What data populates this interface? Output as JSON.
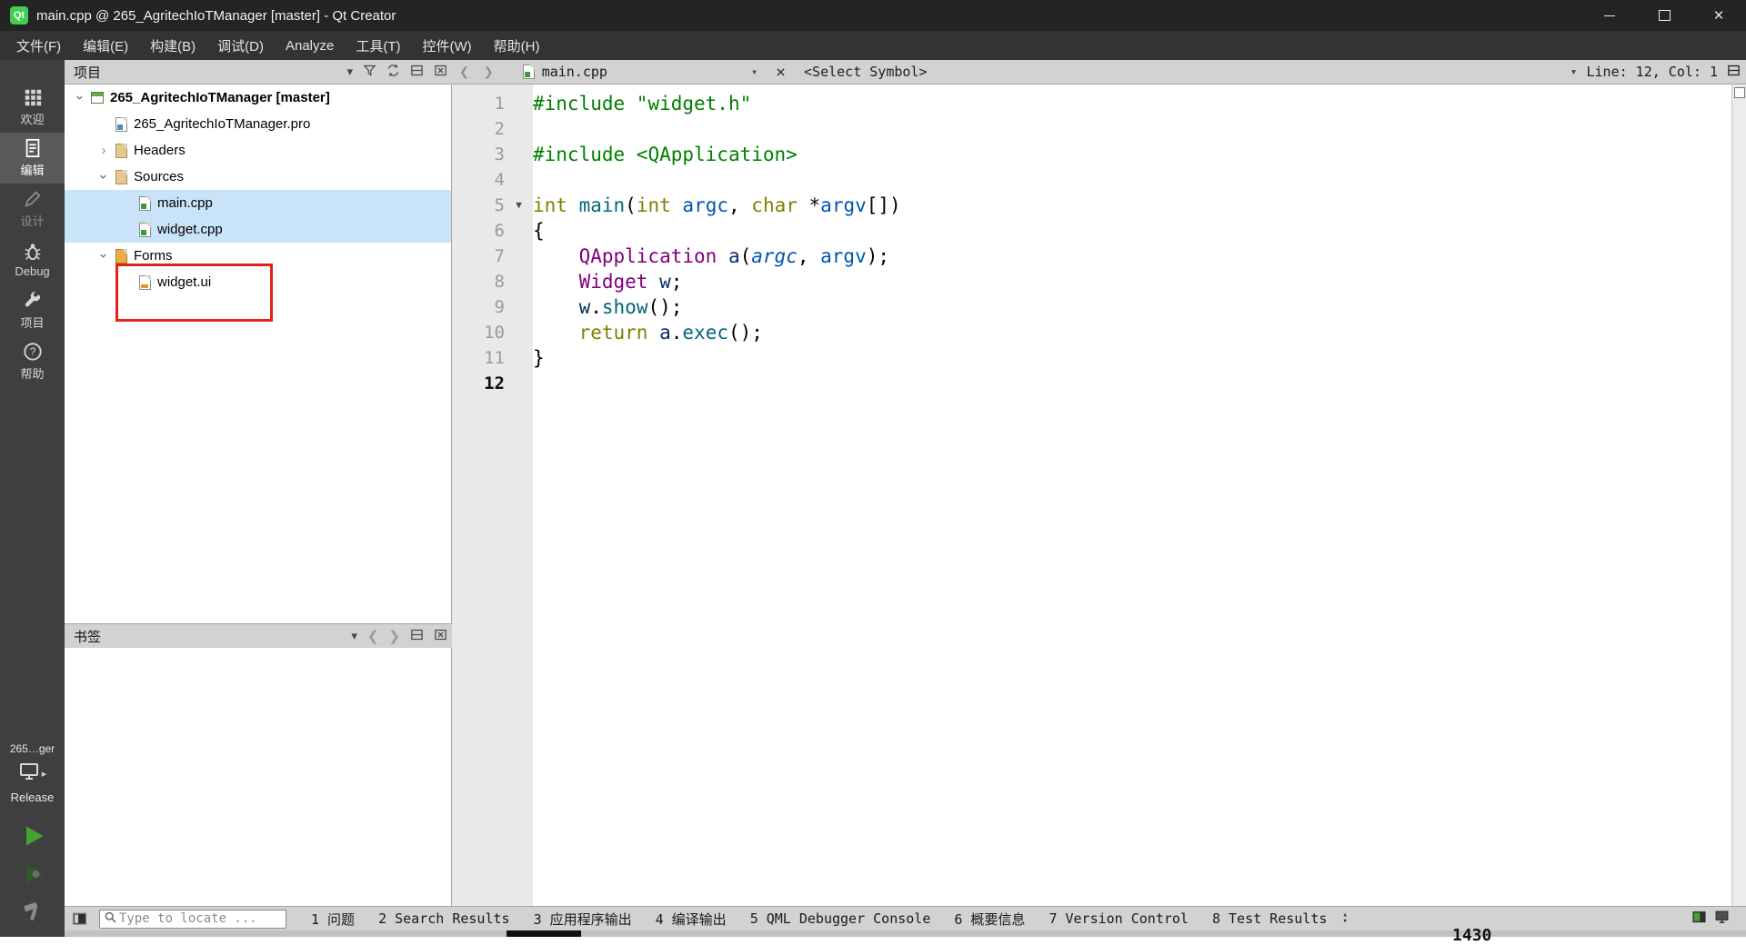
{
  "window": {
    "title": "main.cpp @ 265_AgritechIoTManager [master] - Qt Creator",
    "logo_text": "Qt"
  },
  "menu": {
    "items": [
      "文件(F)",
      "编辑(E)",
      "构建(B)",
      "调试(D)",
      "Analyze",
      "工具(T)",
      "控件(W)",
      "帮助(H)"
    ]
  },
  "modebar": {
    "items": [
      {
        "id": "welcome",
        "label": "欢迎",
        "icon": "grid-icon",
        "state": "normal"
      },
      {
        "id": "edit",
        "label": "编辑",
        "icon": "document-icon",
        "state": "selected"
      },
      {
        "id": "design",
        "label": "设计",
        "icon": "pencil-icon",
        "state": "disabled"
      },
      {
        "id": "debug",
        "label": "Debug",
        "icon": "bug-icon",
        "state": "normal"
      },
      {
        "id": "projects",
        "label": "项目",
        "icon": "wrench-icon",
        "state": "normal"
      },
      {
        "id": "help",
        "label": "帮助",
        "icon": "help-icon",
        "state": "normal"
      }
    ],
    "kit": {
      "project": "265…ger",
      "config": "Release"
    },
    "actions": [
      {
        "id": "run",
        "icon": "run-icon"
      },
      {
        "id": "run-debug",
        "icon": "run-debug-icon"
      },
      {
        "id": "build",
        "icon": "hammer-icon"
      }
    ]
  },
  "project_panel": {
    "title": "项目",
    "tree": [
      {
        "label": "265_AgritechIoTManager [master]",
        "level": 0,
        "icon": "project-icon",
        "chevron": "down",
        "bold": true
      },
      {
        "label": "265_AgritechIoTManager.pro",
        "level": 1,
        "icon": "profile-file-icon",
        "chevron": null
      },
      {
        "label": "Headers",
        "level": 1,
        "icon": "headers-group-icon",
        "chevron": "right"
      },
      {
        "label": "Sources",
        "level": 1,
        "icon": "sources-group-icon",
        "chevron": "down"
      },
      {
        "label": "main.cpp",
        "level": 2,
        "icon": "cpp-file-icon",
        "chevron": null,
        "selected": true
      },
      {
        "label": "widget.cpp",
        "level": 2,
        "icon": "cpp-file-icon",
        "chevron": null,
        "selected": true
      },
      {
        "label": "Forms",
        "level": 1,
        "icon": "forms-group-icon",
        "chevron": "down"
      },
      {
        "label": "widget.ui",
        "level": 2,
        "icon": "ui-file-icon",
        "chevron": null,
        "annotated": true
      }
    ],
    "annotation_color": "#e0241a"
  },
  "bookmarks_panel": {
    "title": "书签"
  },
  "editor": {
    "file_tab": "main.cpp",
    "symbol_selector": "<Select Symbol>",
    "cursor": "Line: 12, Col: 1",
    "code": [
      {
        "n": "1",
        "segs": [
          [
            "pp",
            "#include "
          ],
          [
            "str",
            "\"widget.h\""
          ]
        ]
      },
      {
        "n": "2",
        "segs": []
      },
      {
        "n": "3",
        "segs": [
          [
            "pp",
            "#include "
          ],
          [
            "str",
            "<QApplication>"
          ]
        ]
      },
      {
        "n": "4",
        "segs": []
      },
      {
        "n": "5",
        "fold": true,
        "segs": [
          [
            "kw",
            "int"
          ],
          [
            "pl",
            " "
          ],
          [
            "fn",
            "main"
          ],
          [
            "pl",
            "("
          ],
          [
            "kw",
            "int"
          ],
          [
            "pl",
            " "
          ],
          [
            "loc",
            "argc"
          ],
          [
            "pl",
            ", "
          ],
          [
            "kw",
            "char"
          ],
          [
            "pl",
            " *"
          ],
          [
            "loc",
            "argv"
          ],
          [
            "pl",
            "[])"
          ]
        ]
      },
      {
        "n": "6",
        "segs": [
          [
            "pl",
            "{"
          ]
        ]
      },
      {
        "n": "7",
        "segs": [
          [
            "pl",
            "    "
          ],
          [
            "type",
            "QApplication"
          ],
          [
            "pl",
            " "
          ],
          [
            "var",
            "a"
          ],
          [
            "pl",
            "("
          ],
          [
            "loci",
            "argc"
          ],
          [
            "pl",
            ", "
          ],
          [
            "loc",
            "argv"
          ],
          [
            "pl",
            ");"
          ]
        ]
      },
      {
        "n": "8",
        "segs": [
          [
            "pl",
            "    "
          ],
          [
            "type",
            "Widget"
          ],
          [
            "pl",
            " "
          ],
          [
            "var",
            "w"
          ],
          [
            "pl",
            ";"
          ]
        ]
      },
      {
        "n": "9",
        "segs": [
          [
            "pl",
            "    "
          ],
          [
            "var",
            "w"
          ],
          [
            "pl",
            "."
          ],
          [
            "fn",
            "show"
          ],
          [
            "pl",
            "();"
          ]
        ]
      },
      {
        "n": "10",
        "segs": [
          [
            "pl",
            "    "
          ],
          [
            "kw",
            "return"
          ],
          [
            "pl",
            " "
          ],
          [
            "var",
            "a"
          ],
          [
            "pl",
            "."
          ],
          [
            "fn",
            "exec"
          ],
          [
            "pl",
            "();"
          ]
        ]
      },
      {
        "n": "11",
        "segs": [
          [
            "pl",
            "}"
          ]
        ]
      },
      {
        "n": "12",
        "cur": true,
        "segs": []
      }
    ]
  },
  "status_bar": {
    "locate_placeholder": "Type to locate ...",
    "panes": [
      "1 问题",
      "2 Search Results",
      "3 应用程序输出",
      "4 编译输出",
      "5 QML Debugger Console",
      "6 概要信息",
      "7 Version Control",
      "8 Test Results"
    ]
  },
  "artifacts": {
    "clock": "1430"
  }
}
